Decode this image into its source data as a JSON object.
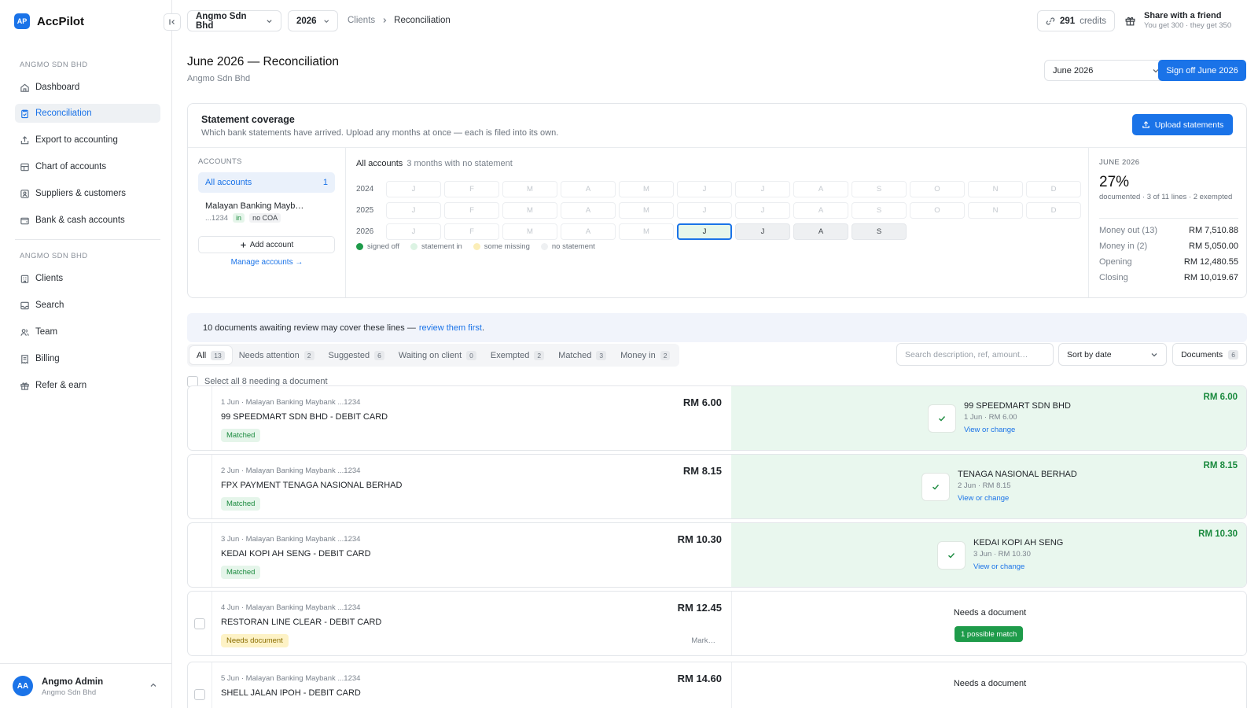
{
  "app": {
    "logo_mark": "AP",
    "name": "AccPilot"
  },
  "sidebar": {
    "section1": "ANGMO SDN BHD",
    "items1": [
      {
        "label": "Dashboard",
        "icon": "home-icon"
      },
      {
        "label": "Reconciliation",
        "icon": "clipboard-icon",
        "active": true
      },
      {
        "label": "Export to accounting",
        "icon": "export-icon"
      },
      {
        "label": "Chart of accounts",
        "icon": "table-icon"
      },
      {
        "label": "Suppliers & customers",
        "icon": "contacts-icon"
      },
      {
        "label": "Bank & cash accounts",
        "icon": "wallet-icon"
      }
    ],
    "section2": "ANGMO SDN BHD",
    "items2": [
      {
        "label": "Clients",
        "icon": "building-icon"
      },
      {
        "label": "Search",
        "icon": "inbox-icon"
      },
      {
        "label": "Team",
        "icon": "users-icon"
      },
      {
        "label": "Billing",
        "icon": "receipt-icon"
      },
      {
        "label": "Refer & earn",
        "icon": "gift-icon"
      }
    ],
    "user": {
      "initials": "AA",
      "name": "Angmo Admin",
      "org": "Angmo Sdn Bhd"
    }
  },
  "topbar": {
    "company": "Angmo Sdn Bhd",
    "year": "2026",
    "breadcrumb": [
      "Clients",
      "Reconciliation"
    ],
    "credits_value": "291",
    "credits_label": "credits",
    "share_title": "Share with a friend",
    "share_sub": "You get 300 · they get 350"
  },
  "page": {
    "title": "June 2026 — Reconciliation",
    "subtitle": "Angmo Sdn Bhd",
    "month_select": "June 2026",
    "signoff_label": "Sign off June 2026"
  },
  "coverage": {
    "title": "Statement coverage",
    "subtitle": "Which bank statements have arrived. Upload any months at once — each is filed into its own.",
    "upload_label": "Upload statements",
    "accounts_label": "ACCOUNTS",
    "all_accounts": "All accounts",
    "all_accounts_count": "1",
    "account_name": "Malayan Banking Mayb…",
    "account_mask": "...1234",
    "account_tag_in": "in",
    "account_tag_coa": "no COA",
    "add_account": "Add account",
    "manage_accounts": "Manage accounts →",
    "grid_title": "All accounts",
    "grid_note": "3 months with no statement",
    "years": [
      {
        "year": "2024",
        "months": [
          "J",
          "F",
          "M",
          "A",
          "M",
          "J",
          "J",
          "A",
          "S",
          "O",
          "N",
          "D"
        ],
        "states": [
          "none",
          "none",
          "none",
          "none",
          "none",
          "none",
          "none",
          "none",
          "none",
          "none",
          "none",
          "none"
        ]
      },
      {
        "year": "2025",
        "months": [
          "J",
          "F",
          "M",
          "A",
          "M",
          "J",
          "J",
          "A",
          "S",
          "O",
          "N",
          "D"
        ],
        "states": [
          "none",
          "none",
          "none",
          "none",
          "none",
          "none",
          "none",
          "none",
          "none",
          "none",
          "none",
          "none"
        ]
      },
      {
        "year": "2026",
        "months": [
          "J",
          "F",
          "M",
          "A",
          "M",
          "J",
          "J",
          "A",
          "S",
          "",
          "",
          ""
        ],
        "states": [
          "none",
          "none",
          "none",
          "none",
          "none",
          "current",
          "in",
          "in",
          "in",
          "empty",
          "empty",
          "empty"
        ]
      }
    ],
    "legend": [
      {
        "label": "signed off",
        "color": "#1e9b4a"
      },
      {
        "label": "statement in",
        "color": "#dcf3e3"
      },
      {
        "label": "some missing",
        "color": "#fbeeb8"
      },
      {
        "label": "no statement",
        "color": "#eef0f2"
      }
    ],
    "stats": {
      "month_label": "JUNE 2026",
      "pct": "27%",
      "desc": "documented · 3 of 11 lines · 2 exempted",
      "rows": [
        {
          "label": "Money out (13)",
          "value": "RM 7,510.88"
        },
        {
          "label": "Money in (2)",
          "value": "RM 5,050.00"
        },
        {
          "label": "Opening",
          "value": "RM 12,480.55"
        },
        {
          "label": "Closing",
          "value": "RM 10,019.67"
        }
      ]
    }
  },
  "banner": {
    "text": "10 documents awaiting review may cover these lines —",
    "link": "review them first",
    "tail": "."
  },
  "tabs": [
    {
      "label": "All",
      "count": "13",
      "active": true
    },
    {
      "label": "Needs attention",
      "count": "2"
    },
    {
      "label": "Suggested",
      "count": "6"
    },
    {
      "label": "Waiting on client",
      "count": "0"
    },
    {
      "label": "Exempted",
      "count": "2"
    },
    {
      "label": "Matched",
      "count": "3"
    },
    {
      "label": "Money in",
      "count": "2"
    }
  ],
  "search_placeholder": "Search description, ref, amount…",
  "sort_label": "Sort by date",
  "documents_label": "Documents",
  "documents_count": "6",
  "select_all": "Select all 8 needing a document",
  "transactions": [
    {
      "meta": "1 Jun · Malayan Banking Maybank ...1234",
      "desc": "99 SPEEDMART SDN BHD - DEBIT CARD",
      "amount": "RM 6.00",
      "status": "Matched",
      "match_name": "99 SPEEDMART SDN BHD",
      "match_sub": "1 Jun · RM 6.00",
      "match_link": "View or change",
      "match_amount": "RM 6.00"
    },
    {
      "meta": "2 Jun · Malayan Banking Maybank ...1234",
      "desc": "FPX PAYMENT TENAGA NASIONAL BERHAD",
      "amount": "RM 8.15",
      "status": "Matched",
      "match_name": "TENAGA NASIONAL BERHAD",
      "match_sub": "2 Jun · RM 8.15",
      "match_link": "View or change",
      "match_amount": "RM 8.15"
    },
    {
      "meta": "3 Jun · Malayan Banking Maybank ...1234",
      "desc": "KEDAI KOPI AH SENG - DEBIT CARD",
      "amount": "RM 10.30",
      "status": "Matched",
      "match_name": "KEDAI KOPI AH SENG",
      "match_sub": "3 Jun · RM 10.30",
      "match_link": "View or change",
      "match_amount": "RM 10.30"
    },
    {
      "meta": "4 Jun · Malayan Banking Maybank ...1234",
      "desc": "RESTORAN LINE CLEAR - DEBIT CARD",
      "amount": "RM 12.45",
      "status": "Needs document",
      "mark": "Mark…",
      "need_text": "Needs a document",
      "possible": "1 possible match"
    },
    {
      "meta": "5 Jun · Malayan Banking Maybank ...1234",
      "desc": "SHELL JALAN IPOH - DEBIT CARD",
      "amount": "RM 14.60",
      "need_text": "Needs a document"
    }
  ]
}
